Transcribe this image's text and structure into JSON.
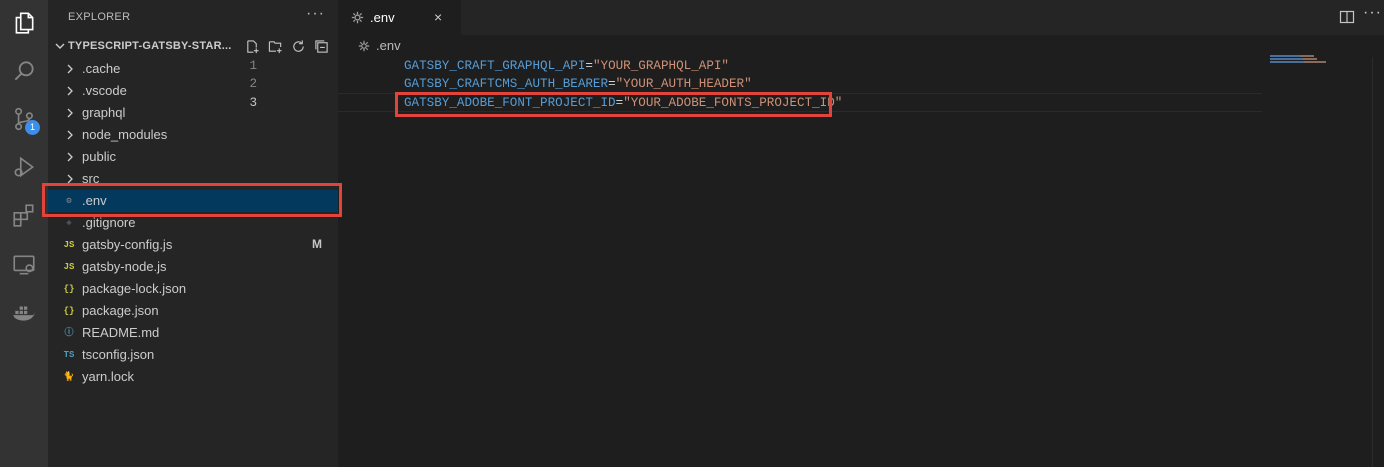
{
  "sidebar": {
    "title": "EXPLORER",
    "more": "···",
    "project": "TYPESCRIPT-GATSBY-STAR...",
    "folders": [
      {
        "label": ".cache"
      },
      {
        "label": ".vscode"
      },
      {
        "label": "graphql"
      },
      {
        "label": "node_modules"
      },
      {
        "label": "public"
      },
      {
        "label": "src"
      }
    ],
    "files": [
      {
        "label": ".env",
        "icon": "gear-icon",
        "glyph": "⚙",
        "color": "#8a8a8a",
        "selected": true,
        "status": ""
      },
      {
        "label": ".gitignore",
        "icon": "git-icon",
        "glyph": "◆",
        "color": "#41535b",
        "selected": false,
        "status": ""
      },
      {
        "label": "gatsby-config.js",
        "icon": "javascript-icon",
        "glyph": "JS",
        "color": "#cbcb41",
        "selected": false,
        "status": "M"
      },
      {
        "label": "gatsby-node.js",
        "icon": "javascript-icon",
        "glyph": "JS",
        "color": "#cbcb41",
        "selected": false,
        "status": ""
      },
      {
        "label": "package-lock.json",
        "icon": "json-icon",
        "glyph": "{}",
        "color": "#cbcb41",
        "selected": false,
        "status": ""
      },
      {
        "label": "package.json",
        "icon": "json-icon",
        "glyph": "{}",
        "color": "#cbcb41",
        "selected": false,
        "status": ""
      },
      {
        "label": "README.md",
        "icon": "info-icon",
        "glyph": "ⓘ",
        "color": "#519aba",
        "selected": false,
        "status": ""
      },
      {
        "label": "tsconfig.json",
        "icon": "typescript-icon",
        "glyph": "TS",
        "color": "#519aba",
        "selected": false,
        "status": ""
      },
      {
        "label": "yarn.lock",
        "icon": "yarn-icon",
        "glyph": "🐈",
        "color": "#519aba",
        "selected": false,
        "status": ""
      }
    ]
  },
  "activity": {
    "scm_badge": "1"
  },
  "tab": {
    "label": ".env",
    "close": "×"
  },
  "breadcrumb": {
    "label": ".env"
  },
  "editor": {
    "lines": [
      {
        "number": "1",
        "key": "GATSBY_CRAFT_GRAPHQL_API",
        "eq": "=",
        "value": "\"YOUR_GRAPHQL_API\""
      },
      {
        "number": "2",
        "key": "GATSBY_CRAFTCMS_AUTH_BEARER",
        "eq": "=",
        "value": "\"YOUR_AUTH_HEADER\""
      },
      {
        "number": "3",
        "key": "GATSBY_ADOBE_FONT_PROJECT_ID",
        "eq": "=",
        "value": "\"YOUR_ADOBE_FONTS_PROJECT_ID\""
      }
    ]
  },
  "colors": {
    "highlight": "#e0443a",
    "selection": "#04395e",
    "key": "#569cd6",
    "string": "#ce9178"
  }
}
